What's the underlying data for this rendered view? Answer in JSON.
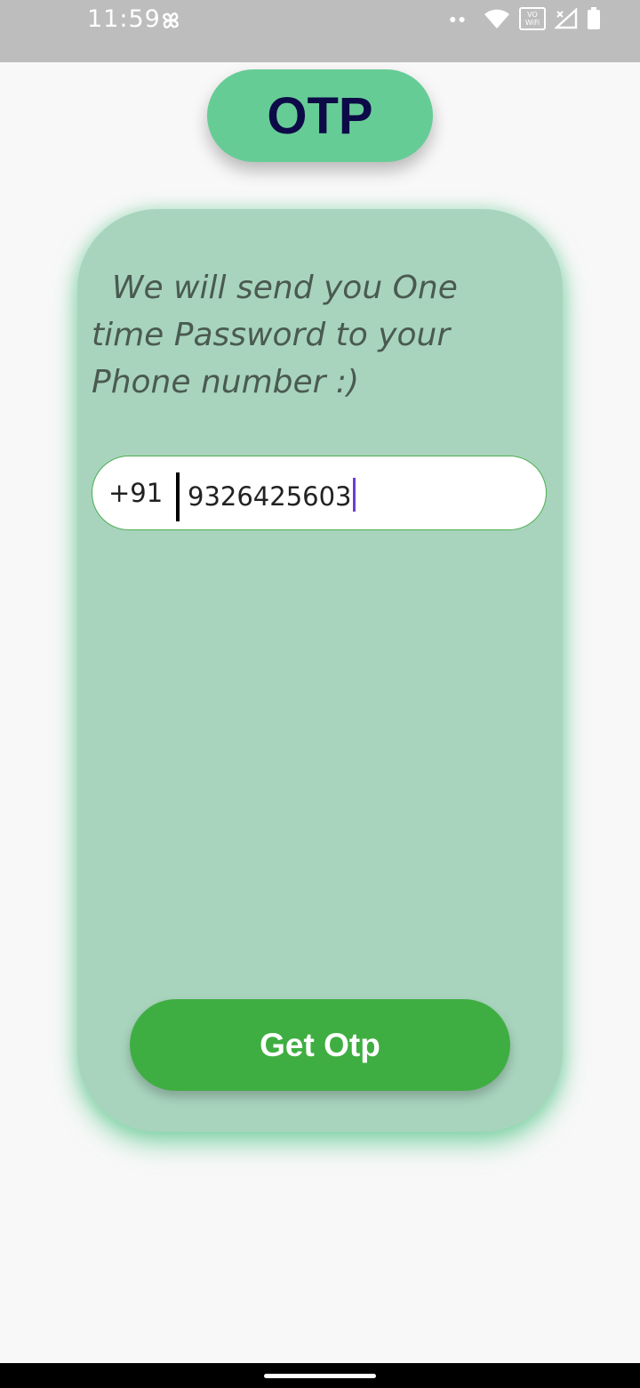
{
  "status_bar": {
    "time": "11:59",
    "vowifi_top": "VO",
    "vowifi_bottom": "WiFi",
    "icons": [
      "pinwheel-app-icon",
      "dots-icon",
      "wifi-icon",
      "vowifi-icon",
      "signal-icon",
      "battery-icon"
    ]
  },
  "header": {
    "title": "OTP"
  },
  "card": {
    "message": "  We will send you One time Password to your Phone number :)"
  },
  "phone_input": {
    "country_code": "+91",
    "value": "9326425603"
  },
  "actions": {
    "get_otp_label": "Get Otp"
  },
  "colors": {
    "title_pill": "#66cc96",
    "title_text": "#0d0a48",
    "card_bg": "#a8d4bd",
    "button_bg": "#3fae42",
    "cursor": "#6a3fd1"
  }
}
